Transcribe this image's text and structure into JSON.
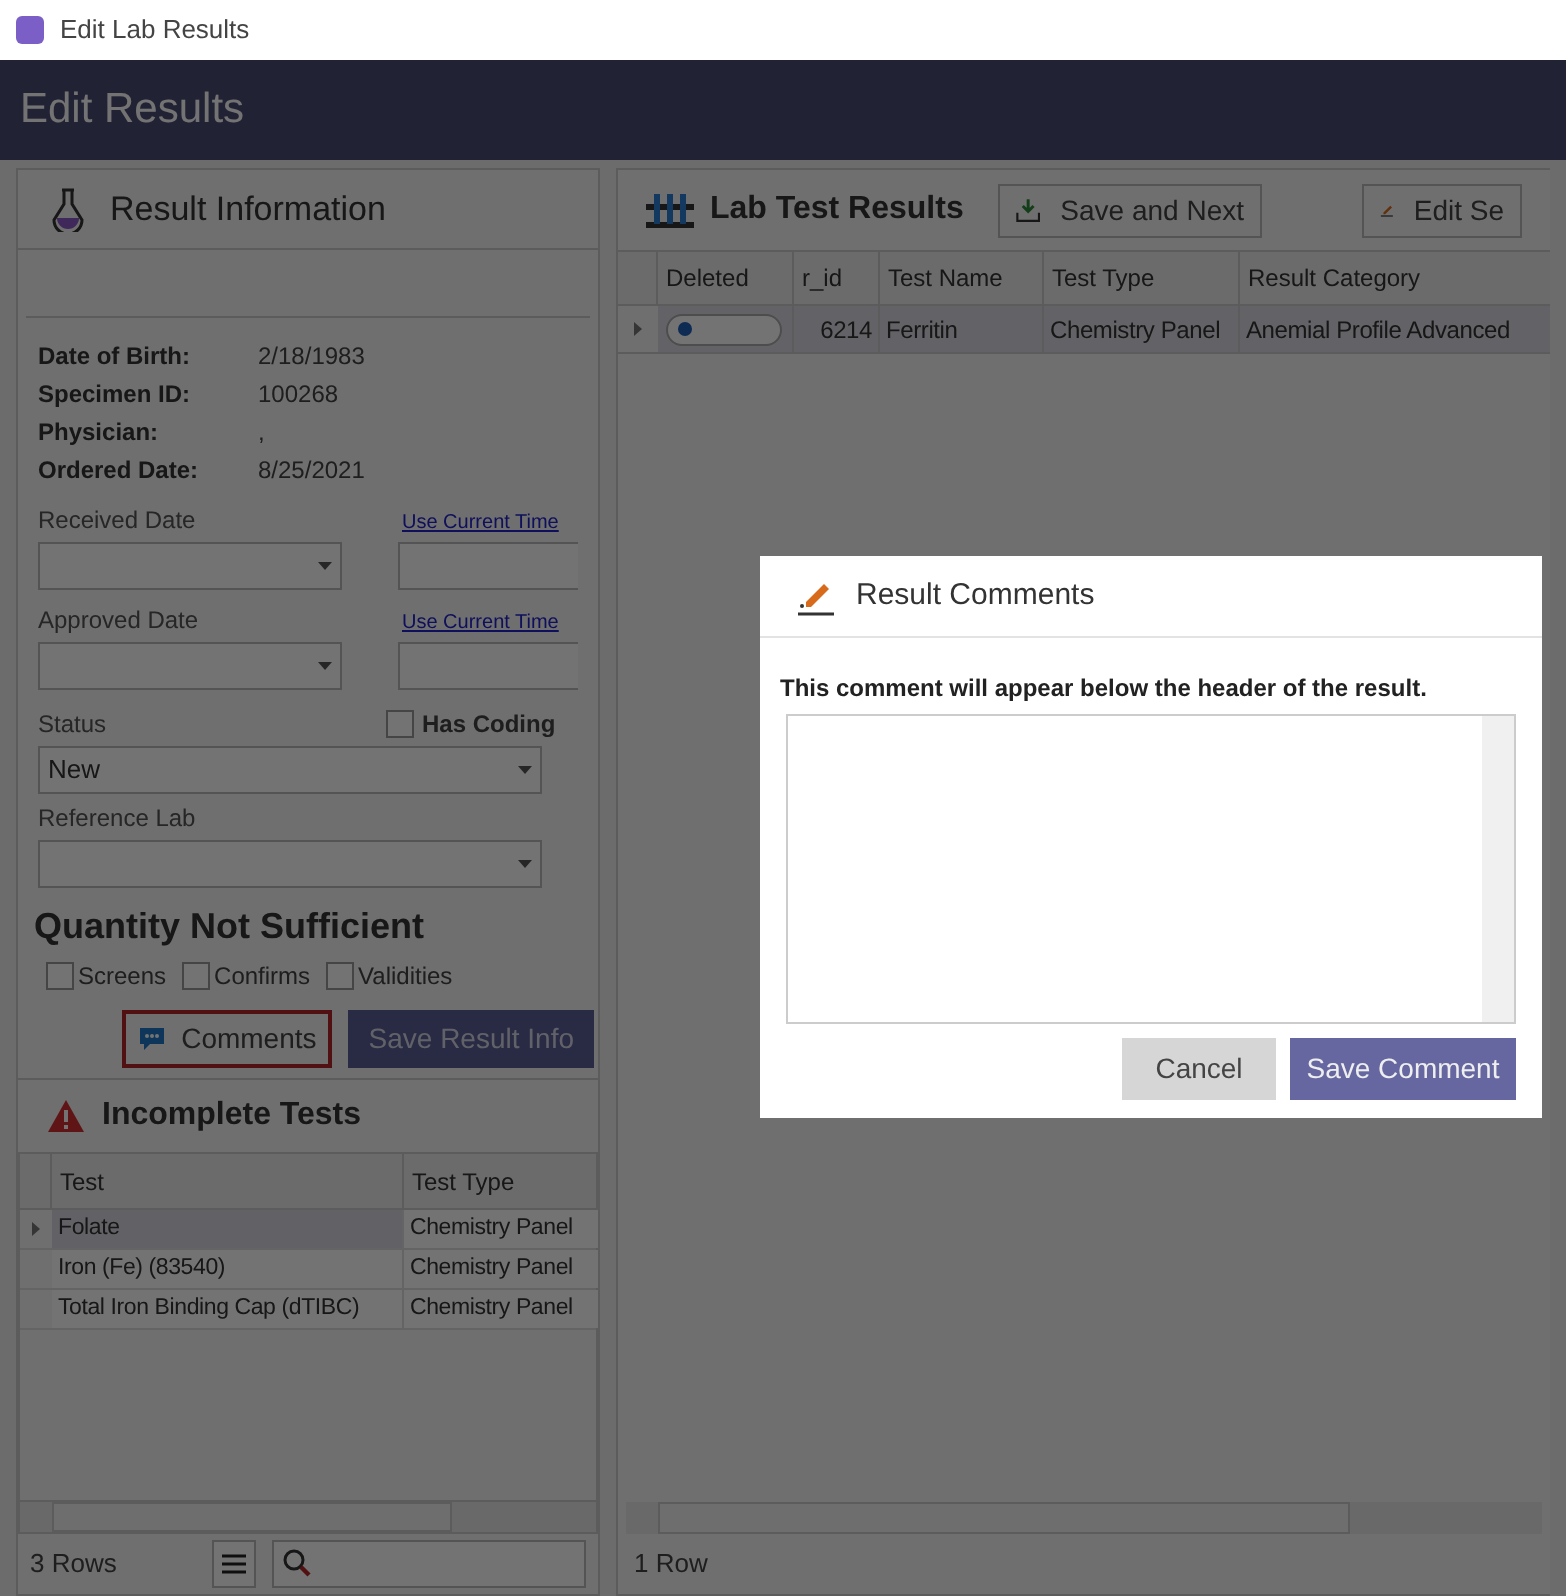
{
  "window": {
    "title": "Edit Lab Results"
  },
  "header": {
    "title": "Edit Results"
  },
  "result_info": {
    "title": "Result Information",
    "details": [
      {
        "label": "Date of Birth:",
        "value": "2/18/1983"
      },
      {
        "label": "Specimen ID:",
        "value": "100268"
      },
      {
        "label": "Physician:",
        "value": ","
      },
      {
        "label": "Ordered Date:",
        "value": "8/25/2021"
      }
    ],
    "received_date": {
      "label": "Received Date",
      "link": "Use Current Time"
    },
    "approved_date": {
      "label": "Approved Date",
      "link": "Use Current Time"
    },
    "status": {
      "label": "Status",
      "value": "New"
    },
    "has_coding": {
      "label": "Has Coding",
      "checked": false
    },
    "reference_lab": {
      "label": "Reference Lab"
    },
    "qns": {
      "title": "Quantity Not Sufficient",
      "options": [
        {
          "label": "Screens",
          "checked": false
        },
        {
          "label": "Confirms",
          "checked": false
        },
        {
          "label": "Validities",
          "checked": false
        }
      ]
    },
    "comments_button": "Comments",
    "save_button": "Save Result Info"
  },
  "incomplete_tests": {
    "title": "Incomplete Tests",
    "columns": [
      "Test",
      "Test Type"
    ],
    "rows": [
      {
        "cells": [
          "Folate",
          "Chemistry Panel"
        ],
        "selected": true
      },
      {
        "cells": [
          "Iron (Fe) (83540)",
          "Chemistry Panel"
        ],
        "selected": false
      },
      {
        "cells": [
          "Total Iron Binding Cap (dTIBC)",
          "Chemistry Panel"
        ],
        "selected": false
      }
    ],
    "footer": "3 Rows"
  },
  "lab_tests": {
    "title": "Lab Test Results",
    "toolbar": [
      "Save and Next",
      "Edit Se"
    ],
    "columns": [
      "Deleted",
      "r_id",
      "Test Name",
      "Test Type",
      "Result Category"
    ],
    "rows": [
      {
        "deleted": false,
        "selected": true,
        "cells": [
          "",
          "6214",
          "Ferritin",
          "Chemistry Panel",
          "Anemial Profile Advanced"
        ]
      }
    ],
    "footer": "1 Row"
  },
  "dialog": {
    "title": "Result Comments",
    "prompt": "This comment will appear below the header of the result.",
    "buttons": [
      "Cancel",
      "Save Comment"
    ]
  }
}
